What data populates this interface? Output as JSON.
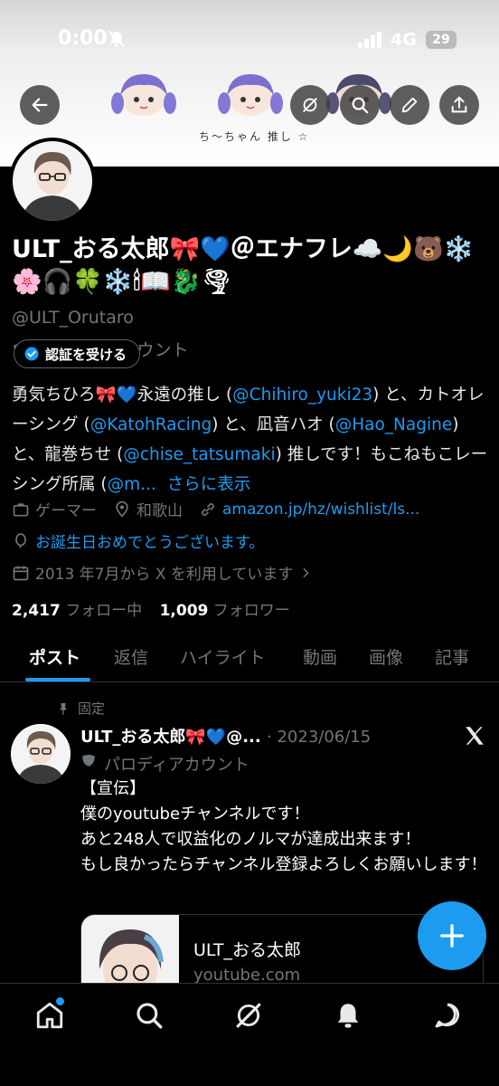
{
  "status_bar": {
    "time": "0:00",
    "network": "4G",
    "battery": "29"
  },
  "banner": {
    "doodle_text": "ち～ちゃん 推し ☆"
  },
  "profile": {
    "display_name": "ULT_おる太郎🎀💙＠エナフレ☁️🌙🐻❄️🌸🎧🍀❄️🕯📖🐉🌪",
    "handle": "@ULT_Orutaro",
    "parody_label": "パロディアカウント",
    "verify_label": "認証を受ける",
    "bio": {
      "p1": "勇気ちひろ🎀💙永遠の推し (",
      "l1": "@Chihiro_yuki23",
      "p2": ") と、カトオレーシング (",
      "l2": "@KatohRacing",
      "p3": ") と、凪音ハオ (",
      "l3": "@Hao_Nagine",
      "p4": ") と、龍巻ちせ (",
      "l4": "@chise_tatsumaki",
      "p5": ") 推しです！もこねもこレーシング所属 (",
      "l5": "@m...",
      "more": "さらに表示"
    },
    "category": "ゲーマー",
    "location": "和歌山",
    "website": "amazon.jp/hz/wishlist/ls...",
    "birthday": "お誕生日おめでとうございます。",
    "joined": "2013 年7月から X を利用しています",
    "following_count": "2,417",
    "following_label": "フォロー中",
    "followers_count": "1,009",
    "followers_label": "フォロワー"
  },
  "tabs": [
    "ポスト",
    "返信",
    "ハイライト",
    "動画",
    "画像",
    "記事"
  ],
  "pinned_post": {
    "pinned_label": "固定",
    "author": "ULT_おる太郎🎀💙@...",
    "date": "· 2023/06/15",
    "parody_label": "パロディアカウント",
    "lines": [
      "【宣伝】",
      "僕のyoutubeチャンネルです！",
      "あと248人で収益化のノルマが達成出来ます！",
      "もし良かったらチャンネル登録よろしくお願いします！"
    ],
    "card_title": "ULT_おる太郎",
    "card_domain": "youtube.com"
  },
  "colors": {
    "accent": "#1d9bf0",
    "muted": "#71767b",
    "background": "#000000"
  }
}
